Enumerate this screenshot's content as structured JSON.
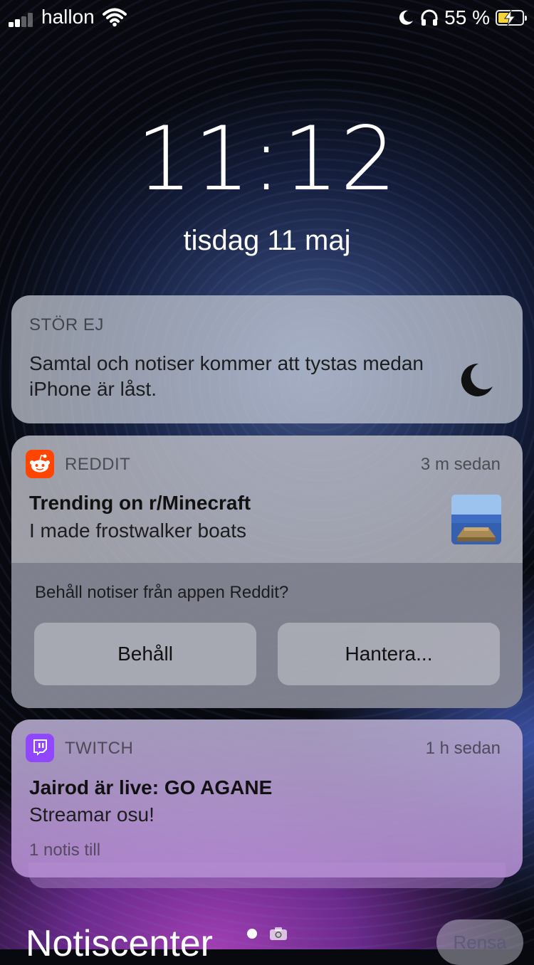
{
  "status_bar": {
    "carrier": "hallon",
    "battery_percent": "55 %",
    "battery_level": 0.55,
    "battery_color": "#f5d33a",
    "icons": [
      "signal-icon",
      "wifi-icon",
      "moon-icon",
      "headphones-icon",
      "battery-charging-icon"
    ]
  },
  "lock": {
    "time": "11:12",
    "date": "tisdag 11 maj"
  },
  "dnd": {
    "title": "STÖR EJ",
    "body": "Samtal och notiser kommer att tystas medan iPhone är låst.",
    "icon": "moon-icon"
  },
  "reddit": {
    "app": "REDDIT",
    "ago": "3 m sedan",
    "title": "Trending on r/Minecraft",
    "body": "I made frostwalker boats",
    "prompt": "Behåll notiser från appen Reddit?",
    "keep_label": "Behåll",
    "manage_label": "Hantera...",
    "brand_color": "#ff4500"
  },
  "twitch": {
    "app": "TWITCH",
    "ago": "1 h sedan",
    "title": "Jairod är live: GO AGANE",
    "body": "Streamar osu!",
    "more": "1 notis till",
    "brand_color": "#9146ff"
  },
  "notification_center": {
    "title": "Notiscenter",
    "clear_label": "Rensa"
  }
}
